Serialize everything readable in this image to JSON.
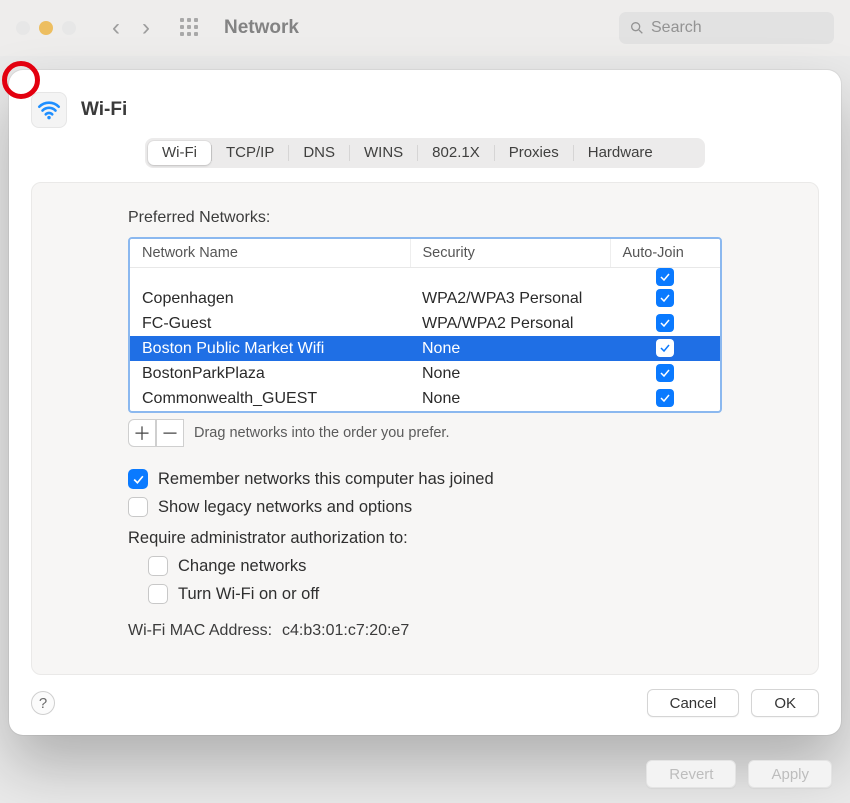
{
  "toolbar": {
    "title": "Network",
    "search_placeholder": "Search"
  },
  "header": {
    "title": "Wi-Fi"
  },
  "tabs": [
    "Wi-Fi",
    "TCP/IP",
    "DNS",
    "WINS",
    "802.1X",
    "Proxies",
    "Hardware"
  ],
  "active_tab_index": 0,
  "section_label": "Preferred Networks:",
  "columns": {
    "name": "Network Name",
    "security": "Security",
    "autojoin": "Auto-Join"
  },
  "networks": [
    {
      "name": "Copenhagen",
      "security": "WPA2/WPA3 Personal",
      "autojoin": true,
      "selected": false
    },
    {
      "name": "FC-Guest",
      "security": "WPA/WPA2 Personal",
      "autojoin": true,
      "selected": false
    },
    {
      "name": "Boston Public Market Wifi",
      "security": "None",
      "autojoin": true,
      "selected": true
    },
    {
      "name": "BostonParkPlaza",
      "security": "None",
      "autojoin": true,
      "selected": false
    },
    {
      "name": "Commonwealth_GUEST",
      "security": "None",
      "autojoin": true,
      "selected": false
    }
  ],
  "drag_hint": "Drag networks into the order you prefer.",
  "options": {
    "remember": {
      "label": "Remember networks this computer has joined",
      "checked": true
    },
    "legacy": {
      "label": "Show legacy networks and options",
      "checked": false
    },
    "admin_label": "Require administrator authorization to:",
    "change_networks": {
      "label": "Change networks",
      "checked": false
    },
    "turn_wifi": {
      "label": "Turn Wi-Fi on or off",
      "checked": false
    }
  },
  "mac": {
    "label": "Wi-Fi MAC Address:",
    "value": "c4:b3:01:c7:20:e7"
  },
  "buttons": {
    "cancel": "Cancel",
    "ok": "OK",
    "revert": "Revert",
    "apply": "Apply",
    "help": "?"
  },
  "icons": {
    "add": "＋",
    "remove": "－"
  }
}
